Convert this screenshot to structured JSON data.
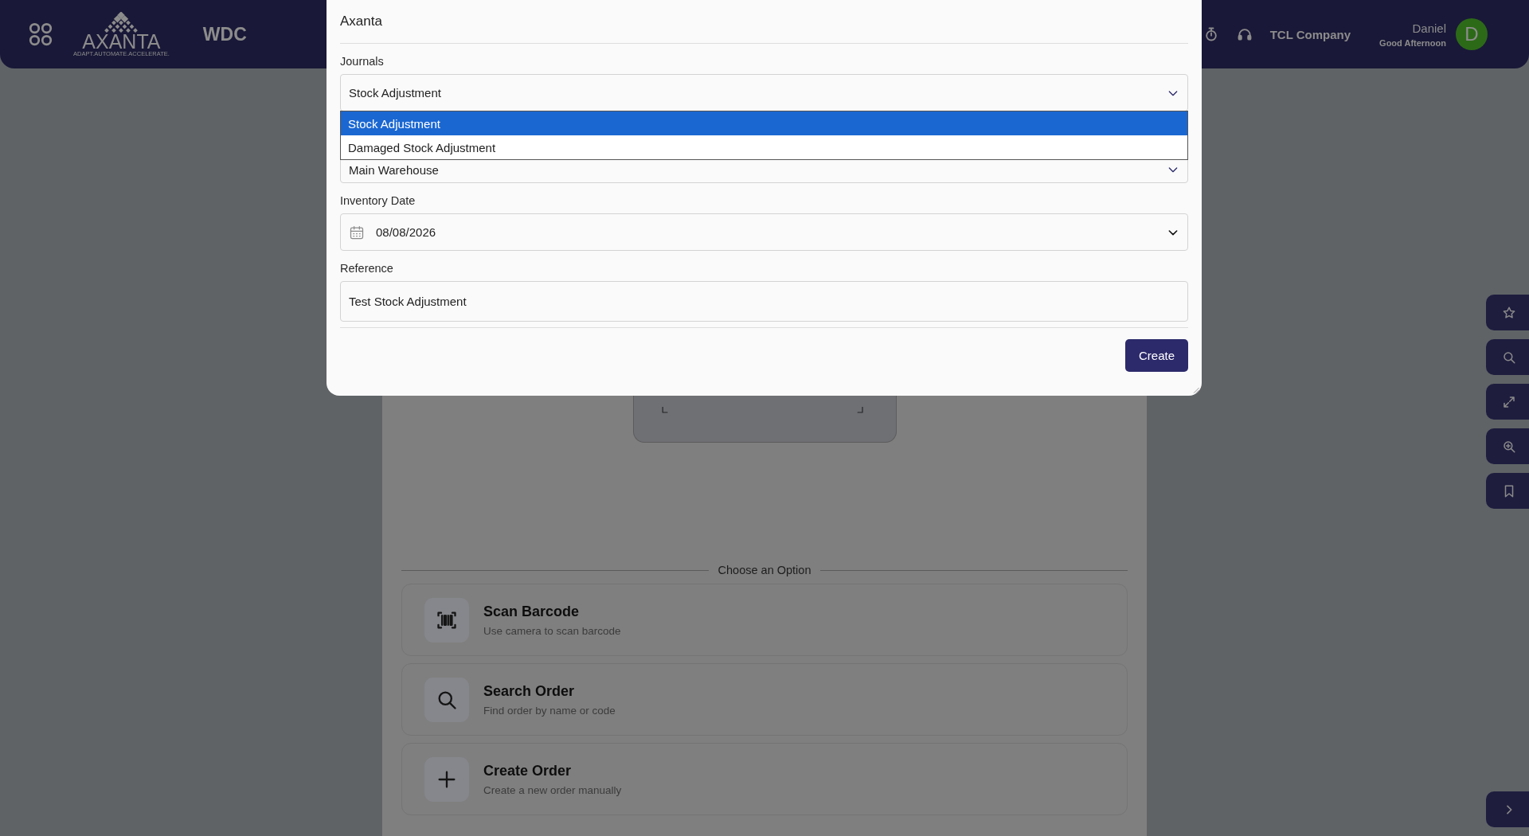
{
  "header": {
    "logo_text": "AXANTA",
    "logo_tagline": "ADAPT.AUTOMATE.ACCELERATE.",
    "site": "WDC",
    "company": "TCL Company",
    "user_name": "Daniel",
    "greeting": "Good Afternoon",
    "avatar_initial": "D"
  },
  "dialog": {
    "title": "Axanta",
    "fields": [
      {
        "kind": "select",
        "label": "Journals",
        "value": "Stock Adjustment",
        "expanded": true,
        "options": [
          {
            "label": "Stock Adjustment",
            "selected": true
          },
          {
            "label": "Damaged Stock Adjustment",
            "selected": false
          }
        ]
      },
      {
        "kind": "select",
        "value": "Main Warehouse"
      },
      {
        "kind": "date",
        "label": "Inventory Date",
        "value": "08/08/2026"
      },
      {
        "kind": "text",
        "label": "Reference",
        "value": "Test Stock Adjustment"
      }
    ],
    "submit": "Create"
  },
  "page": {
    "divider_label": "Choose an Option",
    "options": [
      {
        "kind": "scan",
        "title": "Scan Barcode",
        "subtitle": "Use camera to scan barcode"
      },
      {
        "kind": "search",
        "title": "Search Order",
        "subtitle": "Find order by name or code"
      },
      {
        "kind": "create",
        "title": "Create Order",
        "subtitle": "Create a new order manually"
      }
    ]
  }
}
